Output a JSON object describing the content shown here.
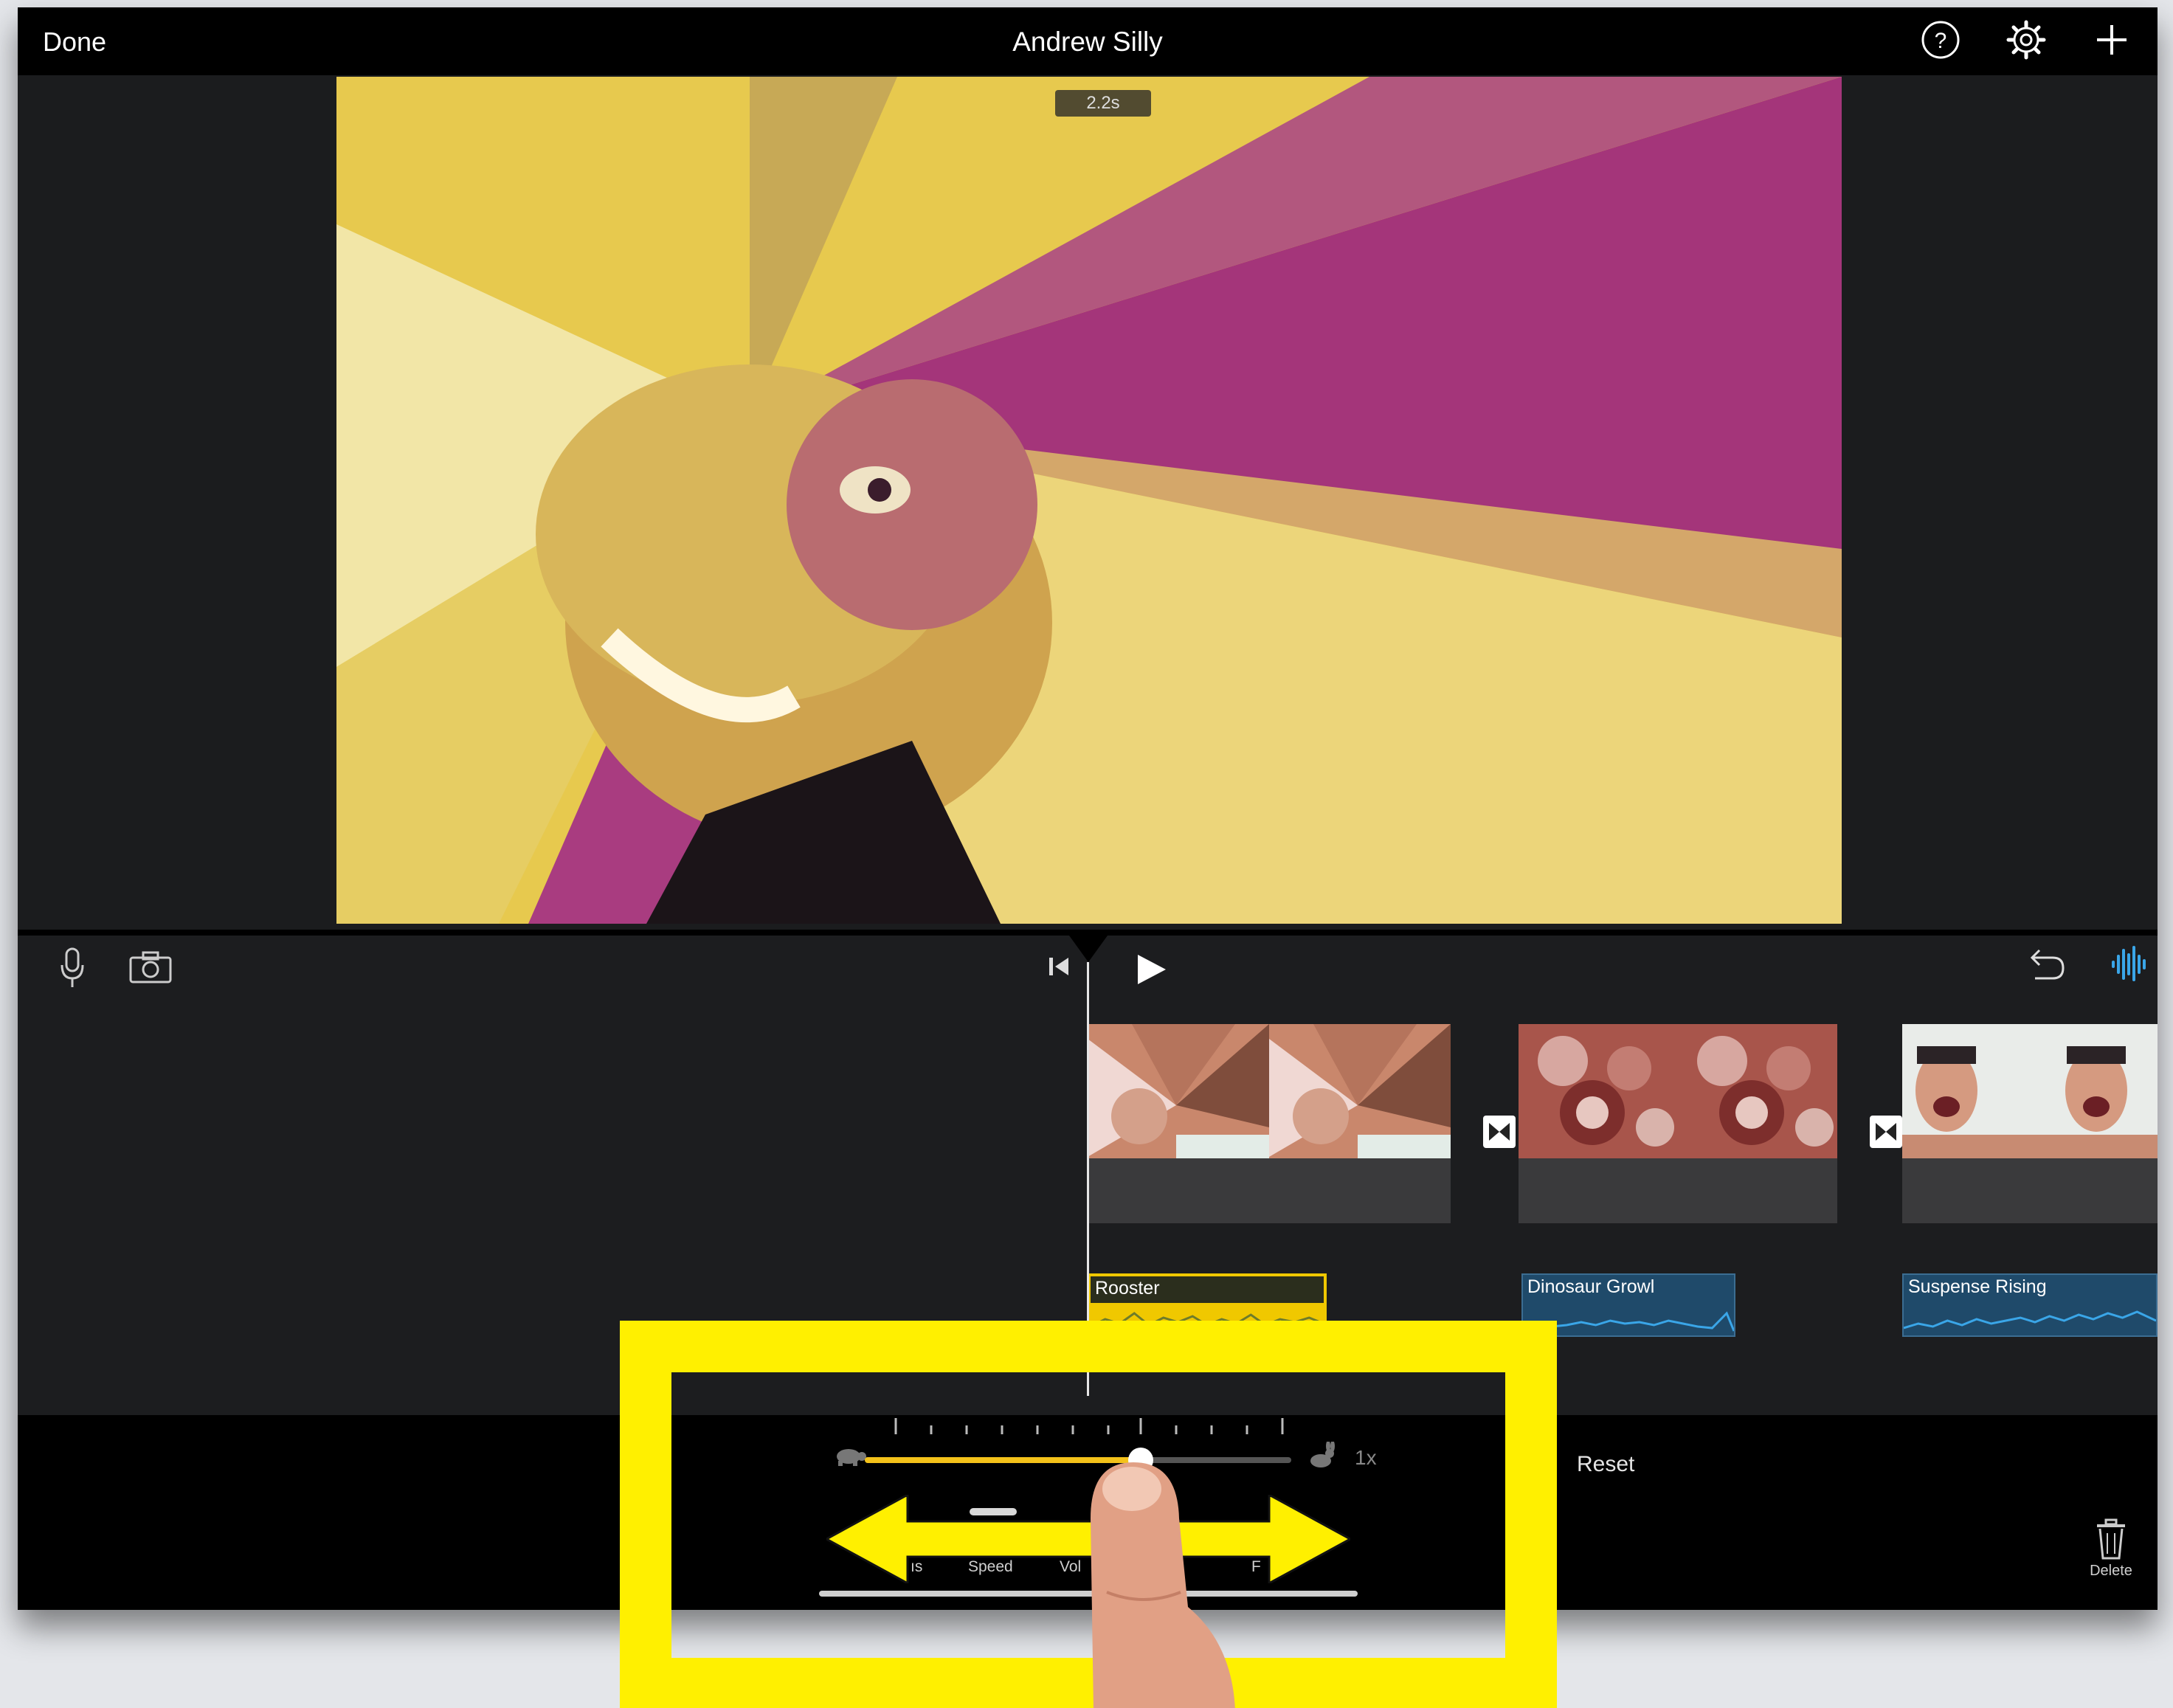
{
  "app": {
    "title": "Andrew Silly",
    "done_label": "Done"
  },
  "preview": {
    "time_badge": "2.2s"
  },
  "timeline": {
    "audio_clips": [
      {
        "label": "Rooster",
        "selected": true
      },
      {
        "label": "Dinosaur Growl",
        "selected": false
      },
      {
        "label": "Suspense Rising",
        "selected": false
      }
    ]
  },
  "inspector": {
    "speed_readout": "1x",
    "speed_level": 0.64,
    "reset_label": "Reset",
    "delete_label": "Delete",
    "tabs": [
      "ıs",
      "Speed",
      "Vol",
      "F"
    ]
  },
  "colors": {
    "highlight": "#fff000",
    "accent": "#f4c21a",
    "audio_wave": "#3aa6e8"
  },
  "icons": [
    "help-icon",
    "settings-gear-icon",
    "add-icon",
    "microphone-icon",
    "camera-icon",
    "skip-to-start-icon",
    "play-icon",
    "undo-icon",
    "audio-waveform-icon",
    "turtle-icon",
    "rabbit-icon",
    "trash-icon"
  ]
}
